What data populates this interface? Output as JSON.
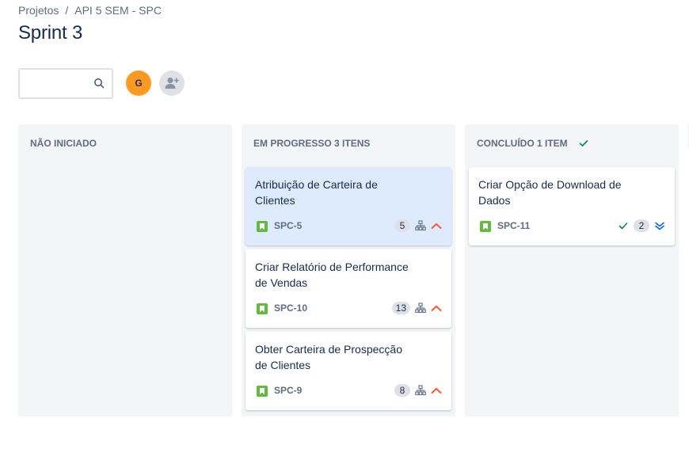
{
  "breadcrumb": {
    "root": "Projetos",
    "separator": "/",
    "project": "API 5 SEM - SPC"
  },
  "page": {
    "title": "Sprint 3"
  },
  "toolbar": {
    "search_value": "",
    "avatar_initial": "G"
  },
  "colors": {
    "accent_avatar": "#ff991f",
    "story": "#63ba3c",
    "priority_high": "#ff5630",
    "priority_lowest": "#0065ff",
    "done": "#00875a"
  },
  "columns": [
    {
      "header": "NÃO INICIADO",
      "cards": []
    },
    {
      "header": "EM PROGRESSO 3 ITENS",
      "cards": [
        {
          "title": "Atribuição de Carteira de Clientes",
          "key": "SPC-5",
          "points": "5",
          "icons": [
            "story-icon",
            "subtask-icon",
            "priority-high-icon"
          ]
        },
        {
          "title": "Criar Relatório de Performance de Vendas",
          "key": "SPC-10",
          "points": "13",
          "icons": [
            "story-icon",
            "subtask-icon",
            "priority-high-icon"
          ]
        },
        {
          "title": "Obter Carteira de Prospecção de Clientes",
          "key": "SPC-9",
          "points": "8",
          "icons": [
            "story-icon",
            "subtask-icon",
            "priority-high-icon"
          ]
        }
      ]
    },
    {
      "header": "CONCLUÍDO 1 ITEM",
      "cards": [
        {
          "title": "Criar Opção de Download de Dados",
          "key": "SPC-11",
          "points": "2",
          "icons": [
            "story-icon",
            "done-check-icon",
            "priority-lowest-icon"
          ]
        }
      ]
    }
  ]
}
